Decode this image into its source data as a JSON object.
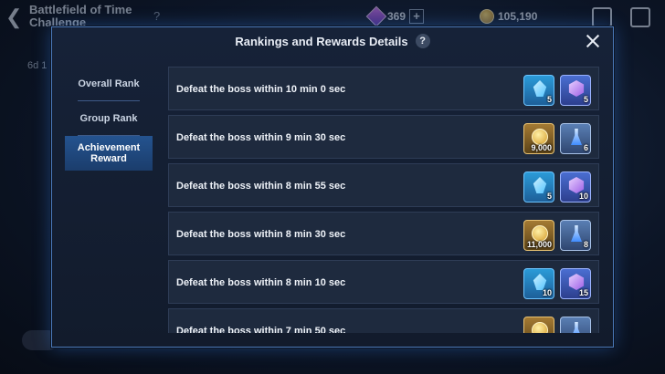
{
  "background": {
    "title": "Battlefield of Time Challenge",
    "help": "?",
    "side_text": "6d 1",
    "resources": [
      {
        "icon": "gem-icon",
        "value": "369"
      },
      {
        "icon": "coin-icon",
        "value": "105,190"
      }
    ]
  },
  "modal": {
    "title": "Rankings and Rewards Details",
    "help": "?"
  },
  "tabs": [
    {
      "label": "Overall Rank",
      "active": false
    },
    {
      "label": "Group Rank",
      "active": false
    },
    {
      "label": "Achievement Reward",
      "active": true
    }
  ],
  "rows": [
    {
      "label": "Defeat the boss within 10 min 0 sec",
      "rewards": [
        {
          "type": "blue-crystal",
          "qty": "5"
        },
        {
          "type": "purple-cube",
          "qty": "5"
        }
      ]
    },
    {
      "label": "Defeat the boss within 9 min 30 sec",
      "rewards": [
        {
          "type": "gold-coin",
          "qty": "9,000"
        },
        {
          "type": "blue-vial",
          "qty": "6"
        }
      ]
    },
    {
      "label": "Defeat the boss within 8 min 55 sec",
      "rewards": [
        {
          "type": "blue-crystal",
          "qty": "5"
        },
        {
          "type": "purple-cube",
          "qty": "10"
        }
      ]
    },
    {
      "label": "Defeat the boss within 8 min 30 sec",
      "rewards": [
        {
          "type": "gold-coin",
          "qty": "11,000"
        },
        {
          "type": "blue-vial",
          "qty": "8"
        }
      ]
    },
    {
      "label": "Defeat the boss within 8 min 10 sec",
      "rewards": [
        {
          "type": "blue-crystal",
          "qty": "10"
        },
        {
          "type": "purple-cube",
          "qty": "15"
        }
      ]
    },
    {
      "label": "Defeat the boss within 7 min 50 sec",
      "rewards": [
        {
          "type": "gold-coin",
          "qty": ""
        },
        {
          "type": "blue-vial",
          "qty": ""
        }
      ]
    }
  ]
}
